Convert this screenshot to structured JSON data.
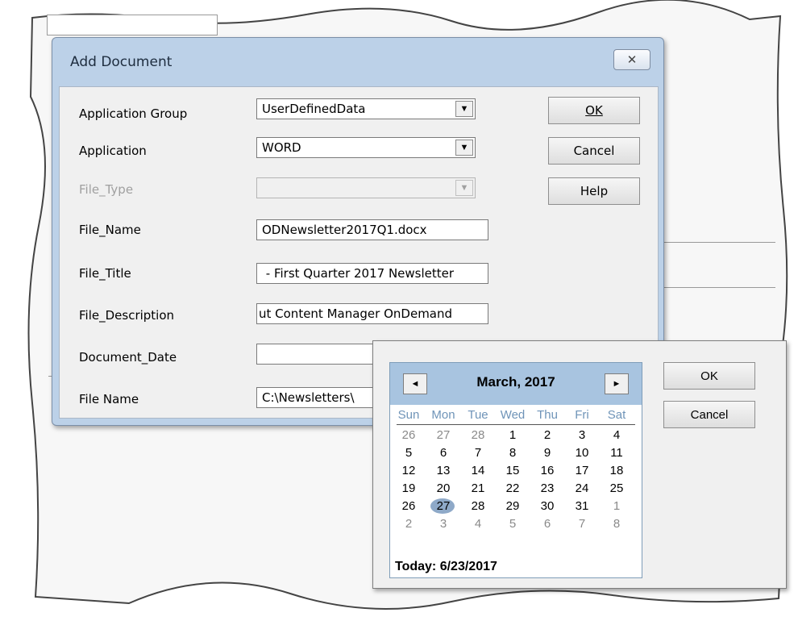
{
  "dialog": {
    "title": "Add Document",
    "close_glyph": "✕",
    "fields": {
      "application_group": {
        "label": "Application Group",
        "value": "UserDefinedData"
      },
      "application": {
        "label": "Application",
        "value": "WORD"
      },
      "file_type": {
        "label": "File_Type",
        "value": ""
      },
      "file_name": {
        "label": "File_Name",
        "value": "ODNewsletter2017Q1.docx"
      },
      "file_title": {
        "label": "File_Title",
        "value": " - First Quarter 2017 Newsletter"
      },
      "file_description": {
        "label": "File_Description",
        "value": "ut Content Manager OnDemand"
      },
      "document_date": {
        "label": "Document_Date",
        "value": ""
      },
      "file_name_path": {
        "label": "File Name",
        "value": "C:\\Newsletters\\"
      }
    },
    "buttons": {
      "ok": "OK",
      "cancel": "Cancel",
      "help": "Help"
    },
    "arrow_glyph": "▼"
  },
  "calendar": {
    "month_label": "March, 2017",
    "prev_glyph": "◄",
    "next_glyph": "►",
    "days_of_week": [
      "Sun",
      "Mon",
      "Tue",
      "Wed",
      "Thu",
      "Fri",
      "Sat"
    ],
    "weeks": [
      [
        "26",
        "27",
        "28",
        "1",
        "2",
        "3",
        "4"
      ],
      [
        "5",
        "6",
        "7",
        "8",
        "9",
        "10",
        "11"
      ],
      [
        "12",
        "13",
        "14",
        "15",
        "16",
        "17",
        "18"
      ],
      [
        "19",
        "20",
        "21",
        "22",
        "23",
        "24",
        "25"
      ],
      [
        "26",
        "27",
        "28",
        "29",
        "30",
        "31",
        "1"
      ],
      [
        "2",
        "3",
        "4",
        "5",
        "6",
        "7",
        "8"
      ]
    ],
    "selected_day": "27",
    "today_label": "Today: 6/23/2017",
    "buttons": {
      "ok": "OK",
      "cancel": "Cancel"
    }
  },
  "colors": {
    "dialog_frame": "#bcd1e8",
    "calendar_header": "#a8c4e0",
    "selected_day": "#8ea9c8",
    "day_of_week_text": "#6f94b8"
  }
}
